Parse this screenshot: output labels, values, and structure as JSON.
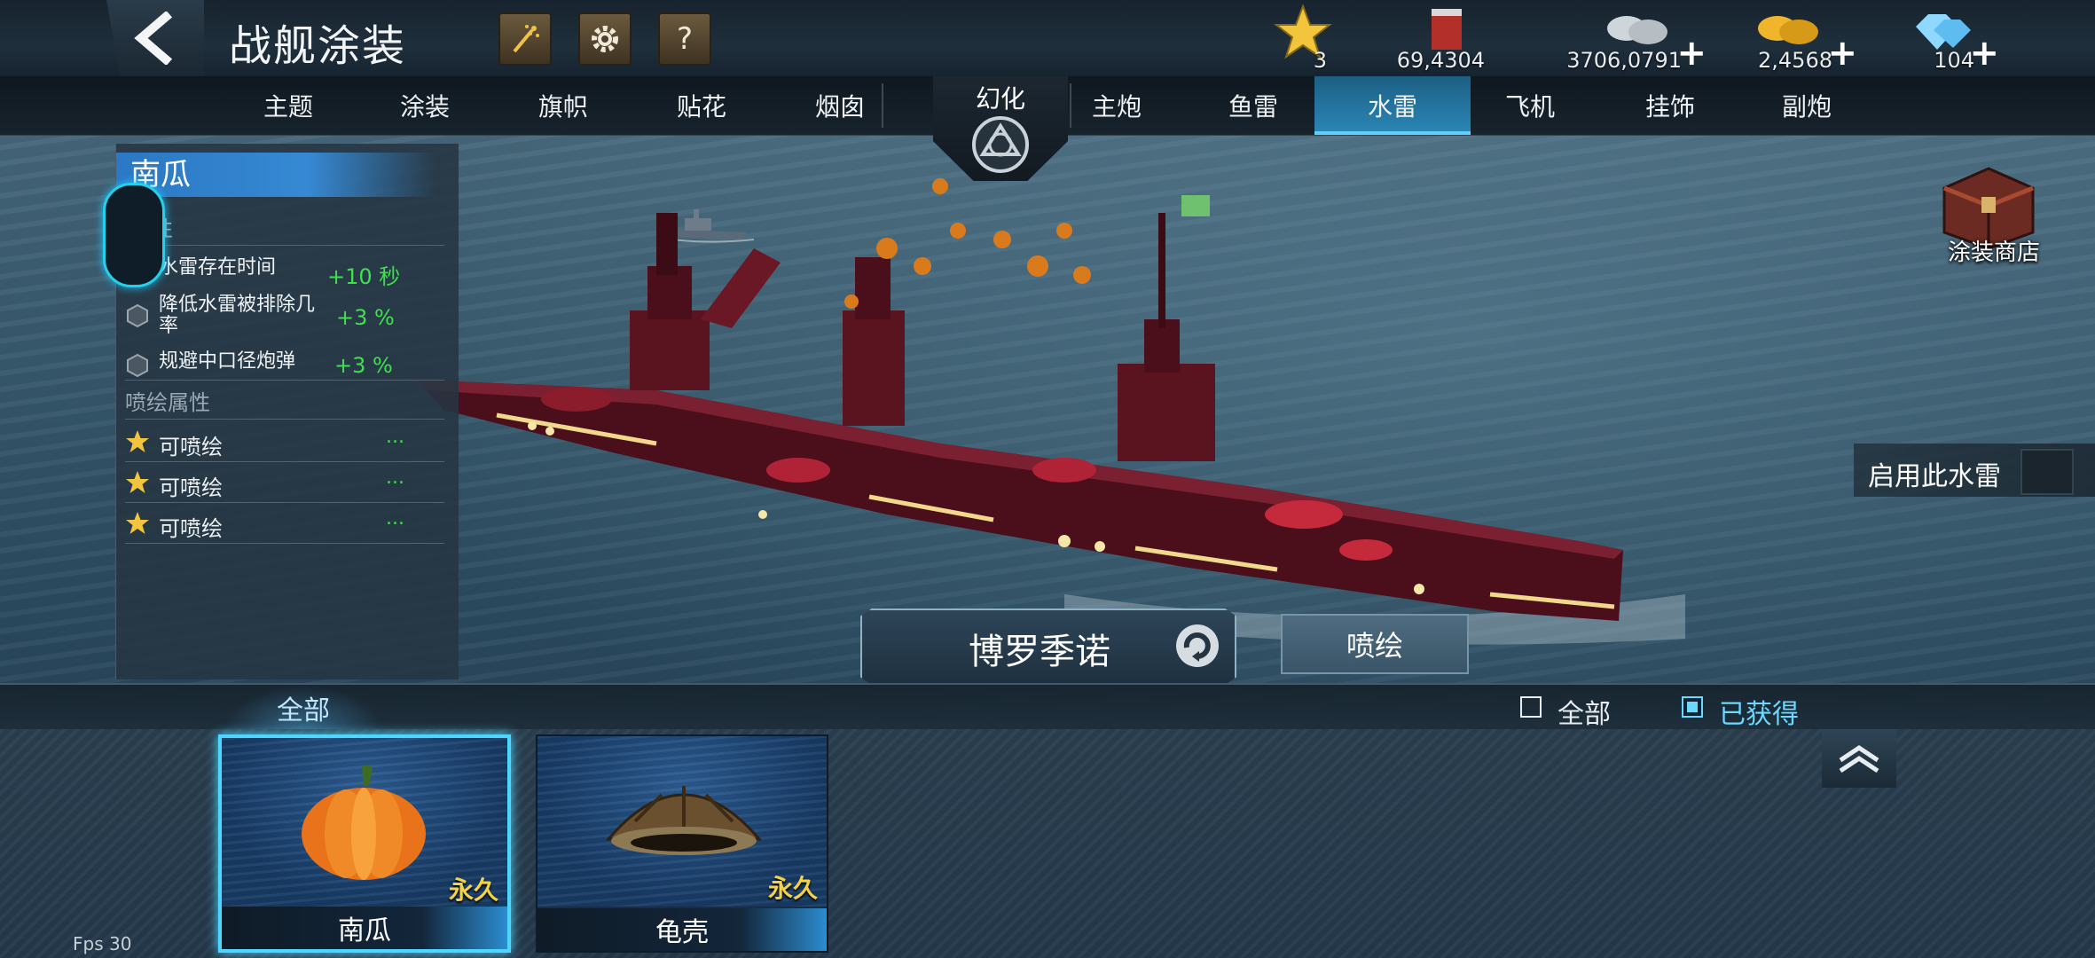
{
  "header": {
    "title": "战舰涂装",
    "buttons": {
      "fireworks_icon": "fireworks-icon",
      "settings_icon": "gear-icon",
      "help_label": "?"
    },
    "resources": [
      {
        "icon": "star-icon",
        "value": "3",
        "has_plus": false
      },
      {
        "icon": "paint-bucket-icon",
        "value": "69,4304",
        "has_plus": false
      },
      {
        "icon": "silver-coins-icon",
        "value": "3706,0791",
        "has_plus": true
      },
      {
        "icon": "gold-coins-icon",
        "value": "2,4568",
        "has_plus": true
      },
      {
        "icon": "diamond-icon",
        "value": "104",
        "has_plus": true
      }
    ],
    "plus_label": "+"
  },
  "tabs": {
    "left": [
      "主题",
      "涂装",
      "旗帜",
      "贴花",
      "烟囱"
    ],
    "center": "幻化",
    "right": [
      "主炮",
      "鱼雷",
      "水雷",
      "飞机",
      "挂饰",
      "副炮"
    ],
    "active": "水雷"
  },
  "info_panel": {
    "skin_name": "南瓜",
    "section_attributes_partial": "性",
    "attributes": [
      {
        "label": "水雷存在时间",
        "value": "+10 秒"
      },
      {
        "label": "降低水雷被排除几率",
        "value": "+3 %"
      },
      {
        "label": "规避中口径炮弹",
        "value": "+3 %"
      }
    ],
    "section_paint": "喷绘属性",
    "paint_slots": [
      {
        "label": "可喷绘",
        "value": "..."
      },
      {
        "label": "可喷绘",
        "value": "..."
      },
      {
        "label": "可喷绘",
        "value": "..."
      }
    ]
  },
  "right_side": {
    "shop_label": "涂装商店",
    "enable_label": "启用此水雷"
  },
  "center": {
    "ship_name": "博罗季诺",
    "paint_button": "喷绘"
  },
  "filter": {
    "category_tab": "全部",
    "check_all": {
      "label": "全部",
      "checked": false
    },
    "check_owned": {
      "label": "已获得",
      "checked": true
    }
  },
  "items": [
    {
      "name": "南瓜",
      "duration": "永久",
      "selected": true,
      "icon": "pumpkin-mine-icon"
    },
    {
      "name": "龟壳",
      "duration": "永久",
      "selected": false,
      "icon": "turtle-shell-mine-icon"
    }
  ],
  "fps": "Fps 30",
  "colors": {
    "accent_blue": "#2a88b8",
    "selected_glow": "#4dd6ff",
    "positive_green": "#3fe04d",
    "duration_gold": "#f3d24a",
    "ship_hull": "#5a1420"
  }
}
